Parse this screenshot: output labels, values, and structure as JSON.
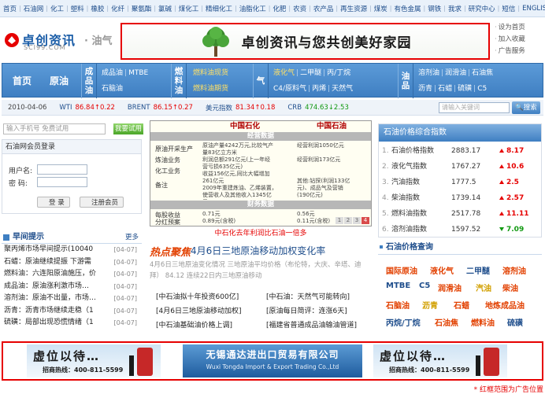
{
  "top_nav": [
    "首页",
    "石油网",
    "化工",
    "塑料",
    "橡胶",
    "化纤",
    "聚氨酯",
    "氯碱",
    "煤化工",
    "精细化工",
    "油脂化工",
    "化肥",
    "农资",
    "农产品",
    "再生资源",
    "煤炭",
    "有色金属",
    "钢铁",
    "我求",
    "研究中心",
    "短信",
    "ENGLISH"
  ],
  "logo": {
    "name": "卓创资讯",
    "url": "SCI99.COM",
    "sub": "· 油气"
  },
  "top_banner": {
    "text": "卓创资讯与您共创美好家园"
  },
  "right_links": [
    "设为首页",
    "加入收藏",
    "广告服务"
  ],
  "main_nav": {
    "home": "首页",
    "crude": "原油",
    "cats": [
      {
        "label": "成品油",
        "rows": [
          [
            "成品油",
            "MTBE"
          ],
          [
            "石脑油"
          ]
        ]
      },
      {
        "label": "燃料油",
        "rows": [
          [
            "燃料油现货"
          ],
          [
            "燃料油期货"
          ]
        ]
      },
      {
        "label": "气",
        "rows": [
          [
            "液化气",
            "二甲醚",
            "丙/丁烷"
          ],
          [
            "C4/原料气",
            "丙烯",
            "天然气"
          ]
        ]
      },
      {
        "label": "油品",
        "rows": [
          [
            "溶剂油",
            "润滑油",
            "石油焦"
          ],
          [
            "沥青",
            "石蜡",
            "硫磺",
            "C5"
          ]
        ]
      }
    ]
  },
  "ticker": {
    "date": "2010-04-06",
    "items": [
      {
        "k": "WTI",
        "v": "86.84↑0.22",
        "color": "#e60000"
      },
      {
        "k": "BRENT",
        "v": "86.15↑0.27",
        "color": "#e60000"
      },
      {
        "k": "美元指数",
        "v": "81.34↑0.18",
        "color": "#e60000"
      },
      {
        "k": "CRB",
        "v": "474.63↓2.53",
        "color": "#119911"
      }
    ],
    "search_placeholder": "请输入关键词",
    "search_button": "搜索"
  },
  "phone": {
    "placeholder": "输入手机号 免费试用",
    "button": "我要试用"
  },
  "login": {
    "title": "石油网会员登录",
    "user_label": "用户名:",
    "pass_label": "密  码:",
    "login_btn": "登 录",
    "register_btn": "注册会员"
  },
  "news": {
    "title": "早间提示",
    "more": "更多",
    "items": [
      {
        "text": "聚丙烯市场早间提示(10040",
        "date": "[04-07]"
      },
      {
        "text": "石蜡：原油继续提振 下游需",
        "date": "[04-07]"
      },
      {
        "text": "燃料油：六连阳原油施压，价",
        "date": "[04-07]"
      },
      {
        "text": "成品油：原油涨利激市场…",
        "date": "[04-07]"
      },
      {
        "text": "溶剂油：原油不出量，市场…",
        "date": "[04-07]"
      },
      {
        "text": "沥青：沥青市场继续走稳（1",
        "date": "[04-07]"
      },
      {
        "text": "硫磺：局部出现恐慌情绪（1",
        "date": "[04-07]"
      }
    ]
  },
  "table": {
    "col1": "中国石化",
    "col2": "中国石油",
    "bar1": "经营数据",
    "bar2": "财务数据",
    "left_labels": [
      "原油开采生产",
      "炼油业务",
      "化工业务",
      "备注"
    ],
    "left_labels2": [
      "每股收益",
      "分红预案"
    ],
    "c1": "原油产量4242万元,比较气产\n量83亿立方米\n利润总额291亿元(上一年经\n营亏损635亿元)\n收益156亿元,同比大幅增加\n261亿元\n2009年重建炼油、乙烯装置，\n使营收人及其他收入1345亿\n元",
    "c2": "经营利润1050亿元\n\n经营利润173亿元\n\n\n其他:钻探(利润133亿\n元)、成品气及营销\n(190亿元)",
    "eps1": "0.71元\n0.89元(含税)",
    "eps2": "0.56元\n0.11元(含税)",
    "pages": [
      "1",
      "2",
      "3",
      "4"
    ],
    "active_page": "4"
  },
  "table_caption": "中石化去年利润比石油一倍多",
  "focus": {
    "tag": "热点聚焦",
    "headline": "4月6日三地原油移动加权变化率",
    "summary": "4月6日三地原油变化情况 三地原油平均价格（布伦特，大庆、辛塔、迪拜） 84.12 连续22日内三地原油移动"
  },
  "links": [
    "[中石油拟十年投资600亿]",
    "[中石油：天然气可能转向]",
    "[4月6日三地原油移动加权]",
    "[原油每日简评：连涨6天]",
    "[中石油基础油价格上调]",
    "[福建省普通成品油输油管道]"
  ],
  "index": {
    "title": "石油价格综合指数",
    "rows": [
      {
        "n": "1.",
        "name": "石油价格指数",
        "val": "2883.17",
        "chg": "8.17",
        "dir": "up"
      },
      {
        "n": "2.",
        "name": "液化气指数",
        "val": "1767.27",
        "chg": "10.6",
        "dir": "up"
      },
      {
        "n": "3.",
        "name": "汽油指数",
        "val": "1777.5",
        "chg": "2.5",
        "dir": "up"
      },
      {
        "n": "4.",
        "name": "柴油指数",
        "val": "1739.14",
        "chg": "2.57",
        "dir": "up"
      },
      {
        "n": "5.",
        "name": "燃料油指数",
        "val": "2517.78",
        "chg": "11.11",
        "dir": "up"
      },
      {
        "n": "6.",
        "name": "溶剂油指数",
        "val": "1597.52",
        "chg": "7.09",
        "dir": "down"
      }
    ]
  },
  "price_query": {
    "title": "石油价格查询",
    "items": [
      {
        "t": "国际原油",
        "c": "#e24000"
      },
      {
        "t": "液化气",
        "c": "#e24000"
      },
      {
        "t": "二甲醚",
        "c": "#1f4e8c"
      },
      {
        "t": "溶剂油",
        "c": "#e24000"
      },
      {
        "t": "MTBE",
        "c": "#1f4e8c"
      },
      {
        "t": "C5",
        "c": "#1f4e8c"
      },
      {
        "t": "润滑油",
        "c": "#e24000"
      },
      {
        "t": "汽油",
        "c": "#d2a000"
      },
      {
        "t": "柴油",
        "c": "#e24000"
      },
      {
        "t": "石脑油",
        "c": "#e24000"
      },
      {
        "t": "沥青",
        "c": "#d2a000"
      },
      {
        "t": "石蜡",
        "c": "#e24000"
      },
      {
        "t": "地炼成品油",
        "c": "#e24000"
      },
      {
        "t": "丙烷/丁烷",
        "c": "#1f4e8c"
      },
      {
        "t": "石油焦",
        "c": "#e24000"
      },
      {
        "t": "燃料油",
        "c": "#e24000"
      },
      {
        "t": "硫磺",
        "c": "#1f4e8c"
      }
    ]
  },
  "bottom_banner": {
    "vacant": "虚位以待…",
    "phone": "招商热线：400-811-5599",
    "company_cn": "无锡通达进出口贸易有限公司",
    "company_en": "Wuxi Tongda Import & Export Trading Co.,Ltd"
  },
  "ad_note": "* 红框范围为广告位置"
}
